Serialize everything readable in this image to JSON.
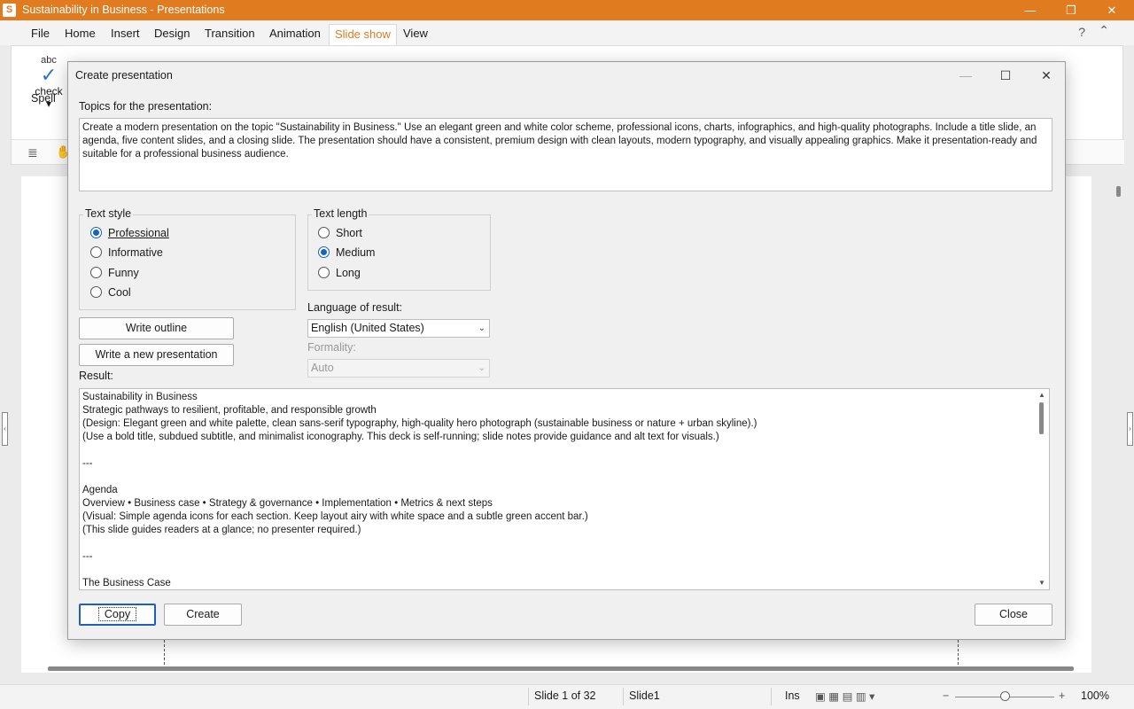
{
  "window": {
    "title": "Sustainability in Business - Presentations",
    "app_icon": "S",
    "minimize": "—",
    "restore": "❐",
    "close": "✕"
  },
  "menu": {
    "items": [
      "File",
      "Home",
      "Insert",
      "Design",
      "Transition",
      "Animation",
      "Slide show",
      "View"
    ],
    "active": "Slide show",
    "help": "?",
    "collapse": "⌃"
  },
  "ribbon": {
    "spell_abc": "abc",
    "spell_label_1": "Spell",
    "spell_label_2": "check ▾"
  },
  "dialog": {
    "title": "Create presentation",
    "topics_label": "Topics for the presentation:",
    "topics_text": "Create a modern presentation on the topic \"Sustainability in Business.\" Use an elegant green and white color scheme, professional icons, charts, infographics, and high-quality photographs. Include a title slide, an agenda, five content slides, and a closing slide. The presentation should have a consistent, premium design with clean layouts, modern typography, and visually appealing graphics. Make it presentation-ready and suitable for a professional business audience.",
    "text_style": {
      "title": "Text style",
      "options": [
        "Professional",
        "Informative",
        "Funny",
        "Cool"
      ],
      "selected": "Professional"
    },
    "text_length": {
      "title": "Text length",
      "options": [
        "Short",
        "Medium",
        "Long"
      ],
      "selected": "Medium"
    },
    "write_outline": "Write outline",
    "write_new": "Write a new presentation",
    "language_label": "Language of result:",
    "language_value": "English (United States)",
    "formality_label": "Formality:",
    "formality_value": "Auto",
    "result_label": "Result:",
    "result_text": "Sustainability in Business\nStrategic pathways to resilient, profitable, and responsible growth\n(Design: Elegant green and white palette, clean sans-serif typography, high-quality hero photograph (sustainable business or nature + urban skyline).)\n(Use a bold title, subdued subtitle, and minimalist iconography. This deck is self-running; slide notes provide guidance and alt text for visuals.)\n\n---\n\nAgenda\nOverview • Business case • Strategy & governance • Implementation • Metrics & next steps\n(Visual: Simple agenda icons for each section. Keep layout airy with white space and a subtle green accent bar.)\n(This slide guides readers at a glance; no presenter required.)\n\n---\n\nThe Business Case",
    "copy": "Copy",
    "create": "Create",
    "close": "Close"
  },
  "status": {
    "slide": "Slide 1 of 32",
    "slide_name": "Slide1",
    "mode": "Ins",
    "zoom": "100%"
  }
}
